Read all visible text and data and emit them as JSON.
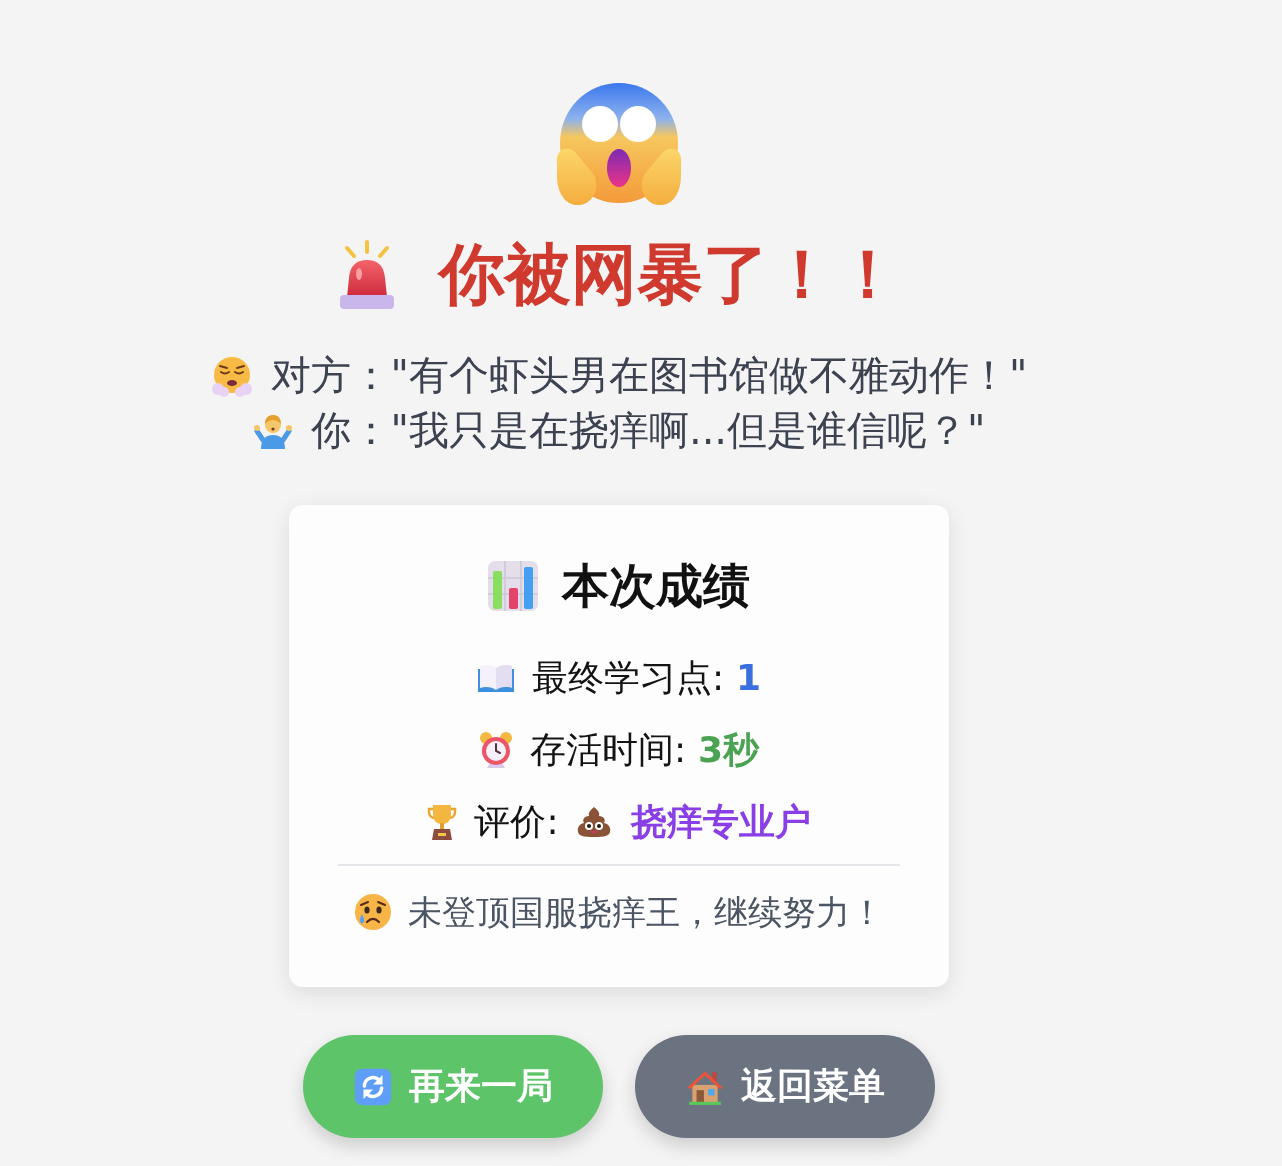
{
  "hero": {
    "title": "你被网暴了！！"
  },
  "dialogue": [
    {
      "kind": "opponent",
      "text": "对方：\"有个虾头男在图书馆做不雅动作！\""
    },
    {
      "kind": "player",
      "text": "你：\"我只是在挠痒啊...但是谁信呢？\""
    }
  ],
  "results": {
    "heading": "本次成绩",
    "stats": [
      {
        "kind": "points",
        "label": "最终学习点:",
        "value": "1",
        "color": "#3b6fe0"
      },
      {
        "kind": "time",
        "label": "存活时间:",
        "value": "3秒",
        "color": "#4aa353"
      },
      {
        "kind": "rating",
        "label": "评价:",
        "value": "挠痒专业户",
        "color": "#8a3fe6"
      }
    ],
    "footer": "未登顶国服挠痒王，继续努力！"
  },
  "buttons": [
    {
      "kind": "restart",
      "label": "再来一局"
    },
    {
      "kind": "menu",
      "label": "返回菜单"
    }
  ]
}
